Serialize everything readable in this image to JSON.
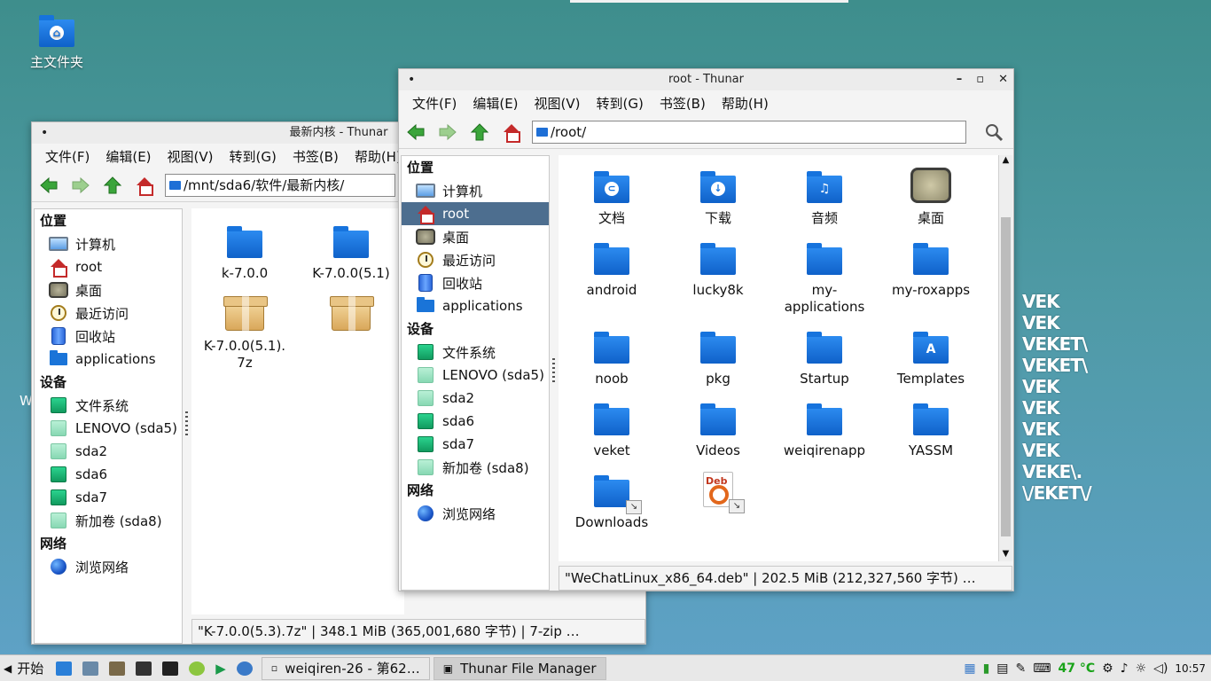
{
  "desktop": {
    "home_label": "主文件夹",
    "partial_w": "W",
    "veket_lines": [
      "VEK",
      "VEK",
      "VEKET\\",
      "VEKET\\",
      "VEK",
      "VEK",
      "VEK",
      "VEK",
      "VEKE\\.",
      "\\/EKET\\/"
    ]
  },
  "window_left": {
    "title": "最新内核 - Thunar",
    "menu": [
      "文件(F)",
      "编辑(E)",
      "视图(V)",
      "转到(G)",
      "书签(B)",
      "帮助(H)"
    ],
    "path": "/mnt/sda6/软件/最新内核/",
    "sidebar": {
      "places_title": "位置",
      "places": [
        "计算机",
        "root",
        "桌面",
        "最近访问",
        "回收站",
        "applications"
      ],
      "devices_title": "设备",
      "devices": [
        "文件系统",
        "LENOVO (sda5)",
        "sda2",
        "sda6",
        "sda7",
        "新加卷 (sda8)"
      ],
      "network_title": "网络",
      "network": [
        "浏览网络"
      ]
    },
    "files": [
      "k-7.0.0",
      "K-7.0.0(5.1)",
      "K-7.0.0(5.1).\n7z",
      ""
    ],
    "status": "\"K-7.0.0(5.3).7z\"  |  348.1 MiB (365,001,680 字节)  |  7-zip …"
  },
  "window_right": {
    "title": "root - Thunar",
    "menu": [
      "文件(F)",
      "编辑(E)",
      "视图(V)",
      "转到(G)",
      "书签(B)",
      "帮助(H)"
    ],
    "path": "/root/",
    "sidebar": {
      "places_title": "位置",
      "places": [
        "计算机",
        "root",
        "桌面",
        "最近访问",
        "回收站",
        "applications"
      ],
      "devices_title": "设备",
      "devices": [
        "文件系统",
        "LENOVO (sda5)",
        "sda2",
        "sda6",
        "sda7",
        "新加卷 (sda8)"
      ],
      "network_title": "网络",
      "network": [
        "浏览网络"
      ]
    },
    "files": [
      "文档",
      "下载",
      "音频",
      "桌面",
      "android",
      "lucky8k",
      "my-\napplications",
      "my-roxapps",
      "noob",
      "pkg",
      "Startup",
      "Templates",
      "veket",
      "Videos",
      "weiqirenapp",
      "YASSM",
      "Downloads",
      ""
    ],
    "status": "\"WeChatLinux_x86_64.deb\"  |  202.5 MiB (212,327,560 字节)  …"
  },
  "taskbar": {
    "start": "开始",
    "tasks": [
      "weiqiren-26 - 第62…",
      "Thunar File Manager"
    ],
    "temperature": "47 °C",
    "clock": "10:57"
  }
}
